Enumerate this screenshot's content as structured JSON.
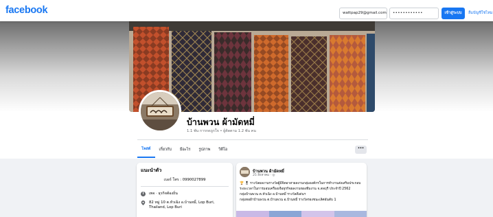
{
  "topbar": {
    "logo": "facebook",
    "email_value": "wattpap29@gmail.com",
    "password_value": "••••••••••••",
    "login_label": "เข้าสู่ระบบ",
    "forgot_label": "ลืมบัญชีใช่ไหม",
    "brand_color": "#1877f2"
  },
  "page": {
    "name": "บ้านพวน ผ้ามัดหมี่",
    "stats": "1.1 พัน การกดถูกใจ • ผู้ติดตาม 1.2 พัน คน"
  },
  "tabs": [
    {
      "label": "โพสต์",
      "active": true
    },
    {
      "label": "เกี่ยวกับ",
      "active": false
    },
    {
      "label": "มีอะไร",
      "active": false
    },
    {
      "label": "รูปภาพ",
      "active": false
    },
    {
      "label": "วิดีโอ",
      "active": false
    }
  ],
  "more_label": "···",
  "intro": {
    "title": "แนะนำตัว",
    "bio": "เบอร์ โทร : 0990027899",
    "category": "เพจ · ธุรกิจท้องถิ่น",
    "address_line1": "82 หมู่ 10 ต.หัวเฉิง อ.บ้านหมี่, Lop Buri,",
    "address_line2": "Thailand, Lop Buri"
  },
  "post": {
    "author": "บ้านพวน ผ้ามัดหมี่",
    "time": "25 สิงหาคม · ◎",
    "lines": [
      "🏆 🎖 รางวัลผลงานรางวัลผู้มีจิตอาสาผลงานกลุ่มองค์กรในการทำงานส่งเสริมประกอบ",
      "ระยะเวลาในการมอบเครื่องเจือธุรกิจผลงานของทีมงาน จ.ลพบุรี ประจำปี 2562",
      "กลุ่มบ้านพวน  ต.หัวเฉิง  อ.บ้านหมี่  รางวัลดีเด่นฯ",
      "กลุ่มทอผ้าบ้านพวน  ต.บ้านพวน อ.บ้านหมี่  รางวัลรองชนะเลิศอันดับ 1"
    ]
  }
}
